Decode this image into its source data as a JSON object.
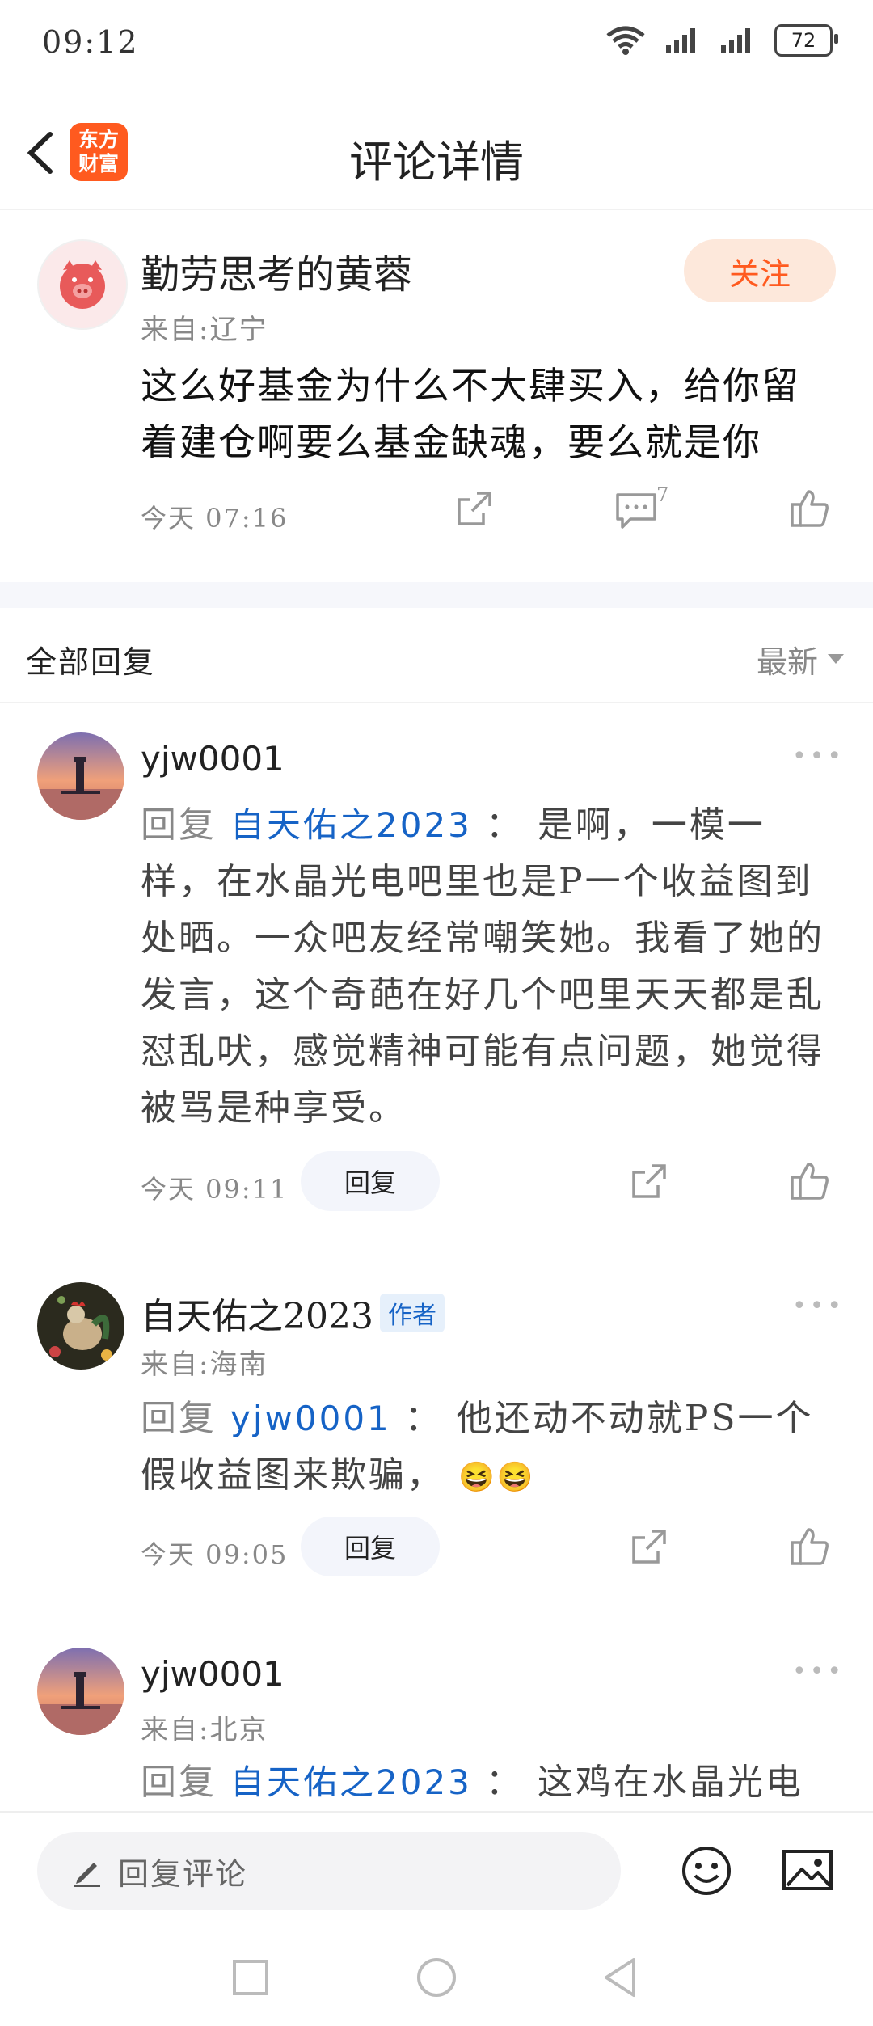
{
  "status_bar": {
    "time": "09:12",
    "battery": "72"
  },
  "header": {
    "title": "评论详情",
    "logo_line1": "东方",
    "logo_line2": "财富"
  },
  "post": {
    "author": "勤劳思考的黄蓉",
    "location": "来自:辽宁",
    "follow_label": "关注",
    "text": "这么好基金为什么不大肆买入，给你留着建仓啊要么基金缺魂，要么就是你",
    "time": "今天  07:16",
    "comment_count": "7"
  },
  "replies_section": {
    "title": "全部回复",
    "sort_label": "最新"
  },
  "replies": [
    {
      "author": "yjw0001",
      "reply_prefix": "回复",
      "mention": "自天佑之2023",
      "separator": "：",
      "text": "是啊，一模一样，在水晶光电吧里也是P一个收益图到处晒。一众吧友经常嘲笑她。我看了她的发言，这个奇葩在好几个吧里天天都是乱怼乱吠，感觉精神可能有点问题，她觉得被骂是种享受。",
      "time": "今天  09:11",
      "reply_btn": "回复"
    },
    {
      "author": "自天佑之2023",
      "badge": "作者",
      "location": "来自:海南",
      "reply_prefix": "回复",
      "mention": "yjw0001",
      "separator": "：",
      "text": "他还动不动就PS一个假收益图来欺骗，",
      "emoji": "😆😆",
      "time": "今天  09:05",
      "reply_btn": "回复"
    },
    {
      "author": "yjw0001",
      "location": "来自:北京",
      "reply_prefix": "回复",
      "mention": "自天佑之2023",
      "separator": "：",
      "text": "这鸡在水晶光电"
    }
  ],
  "bottom_bar": {
    "input_placeholder": "回复评论"
  },
  "colors": {
    "accent": "#ff5a1f",
    "link": "#1663c6"
  }
}
